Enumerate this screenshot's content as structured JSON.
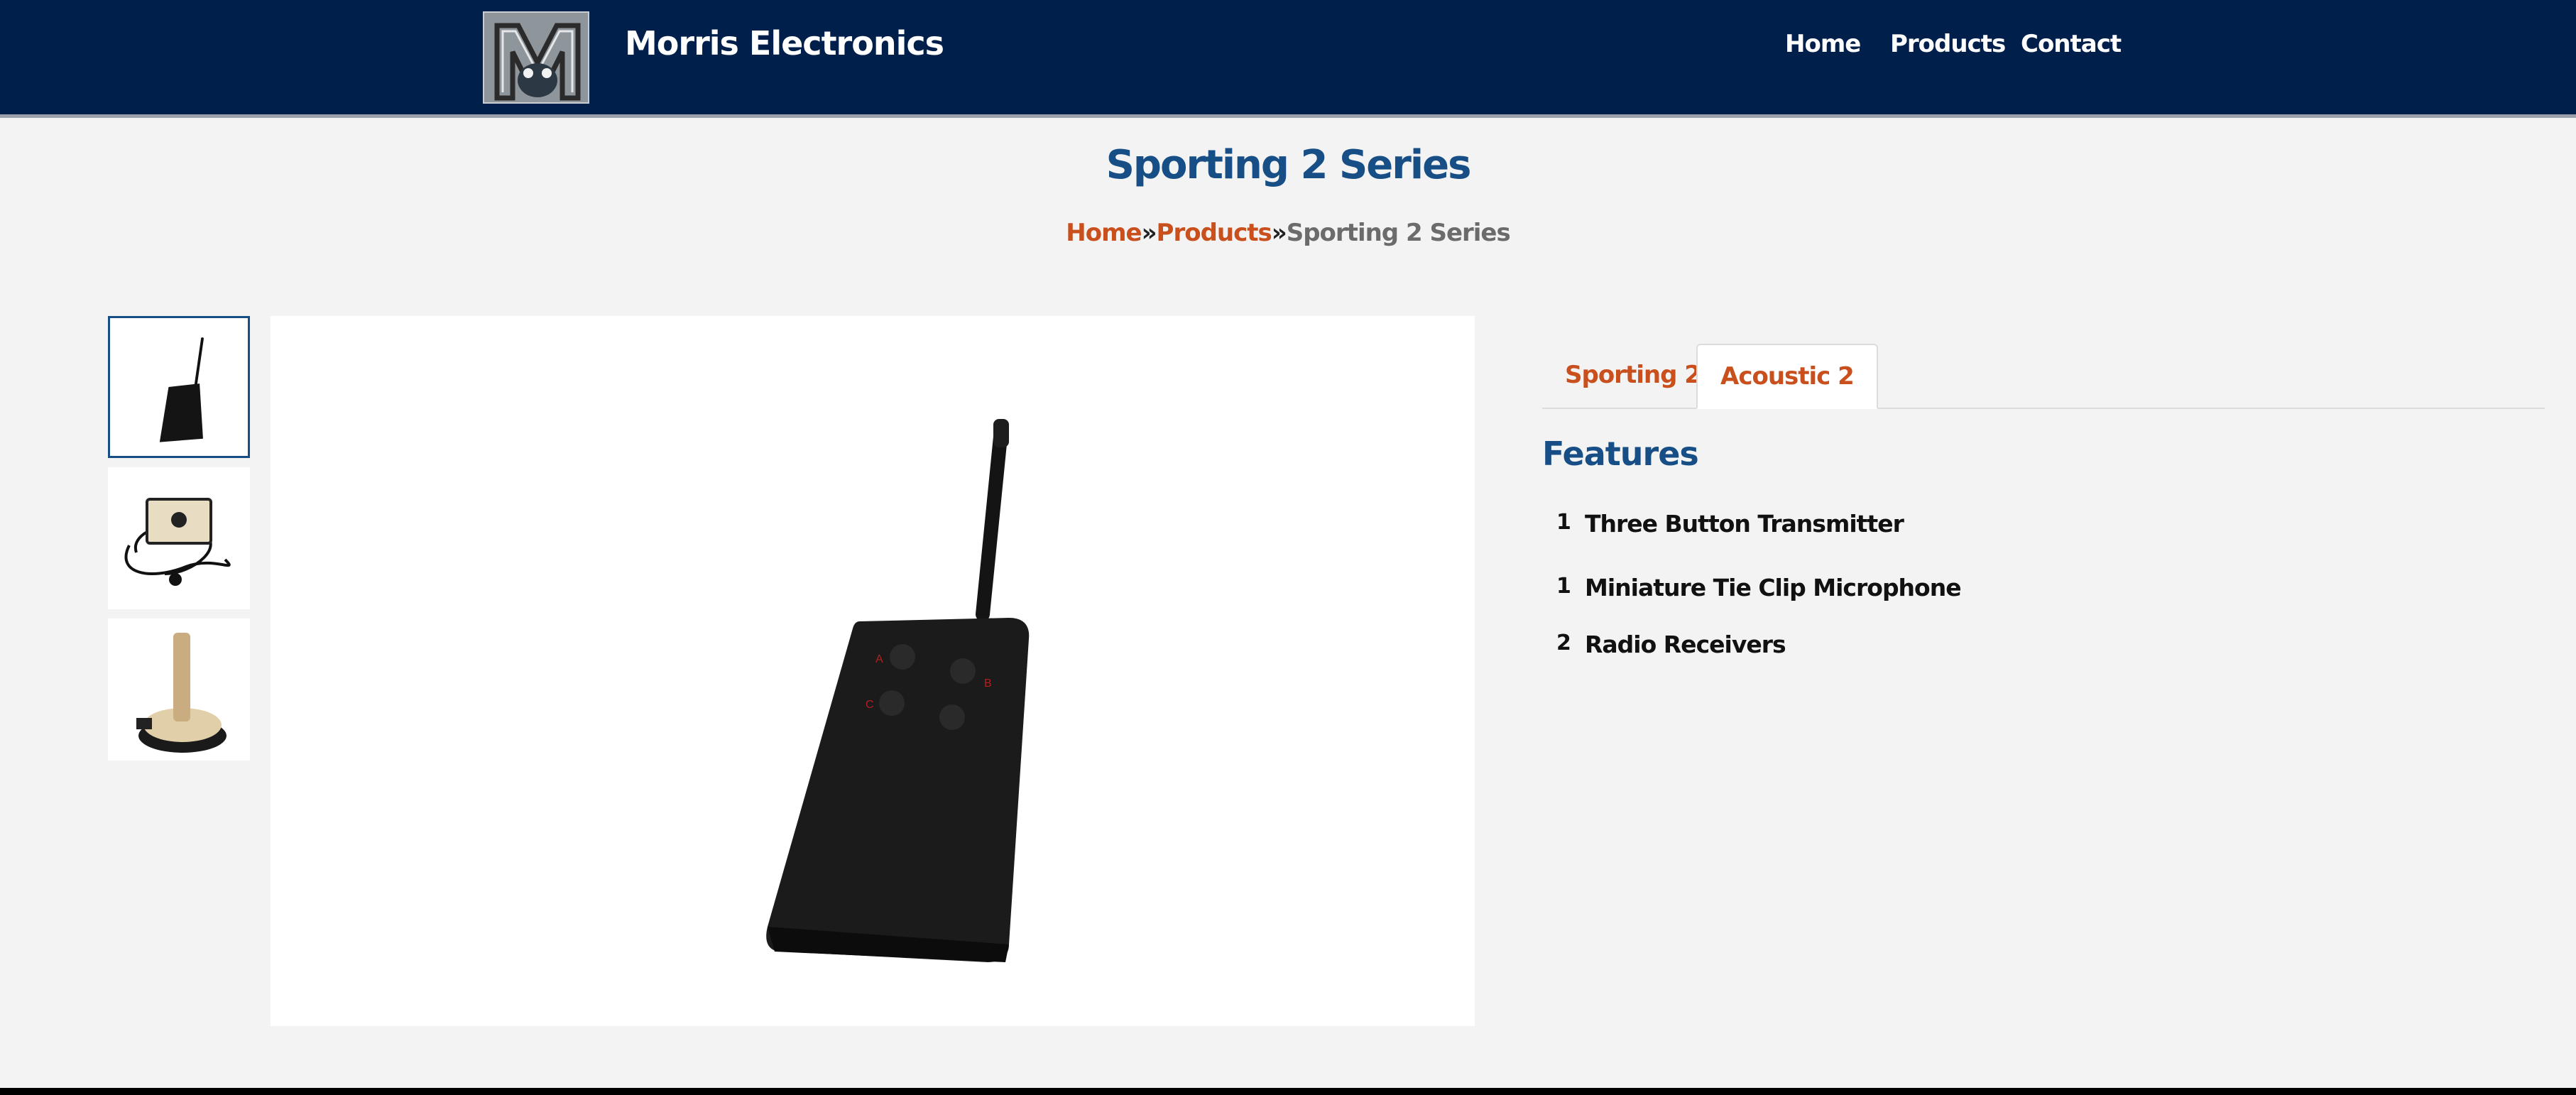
{
  "header": {
    "brand": "Morris Electronics",
    "nav": [
      {
        "label": "Home"
      },
      {
        "label": "Products"
      },
      {
        "label": "Contact"
      }
    ]
  },
  "page": {
    "title": "Sporting 2 Series",
    "breadcrumb": {
      "home": "Home",
      "separator": "»",
      "products": "Products",
      "current": "Sporting 2 Series"
    }
  },
  "gallery": {
    "thumbnails": [
      {
        "icon": "transmitter-image",
        "active": true
      },
      {
        "icon": "microphone-receiver-image",
        "active": false
      },
      {
        "icon": "candle-receiver-image",
        "active": false
      }
    ],
    "main_image": {
      "icon": "transmitter-image"
    }
  },
  "tabs": [
    {
      "label": "Sporting 2",
      "active": false
    },
    {
      "label": "Acoustic 2",
      "active": true
    }
  ],
  "features": {
    "heading": "Features",
    "items": [
      {
        "qty": "1",
        "label": "Three Button Transmitter"
      },
      {
        "qty": "1",
        "label": "Miniature Tie Clip Microphone"
      },
      {
        "qty": "2",
        "label": "Radio Receivers"
      }
    ]
  },
  "colors": {
    "header_bg": "#001f4a",
    "title": "#174e86",
    "link": "#c9501d",
    "page_bg": "#f3f3f3"
  }
}
